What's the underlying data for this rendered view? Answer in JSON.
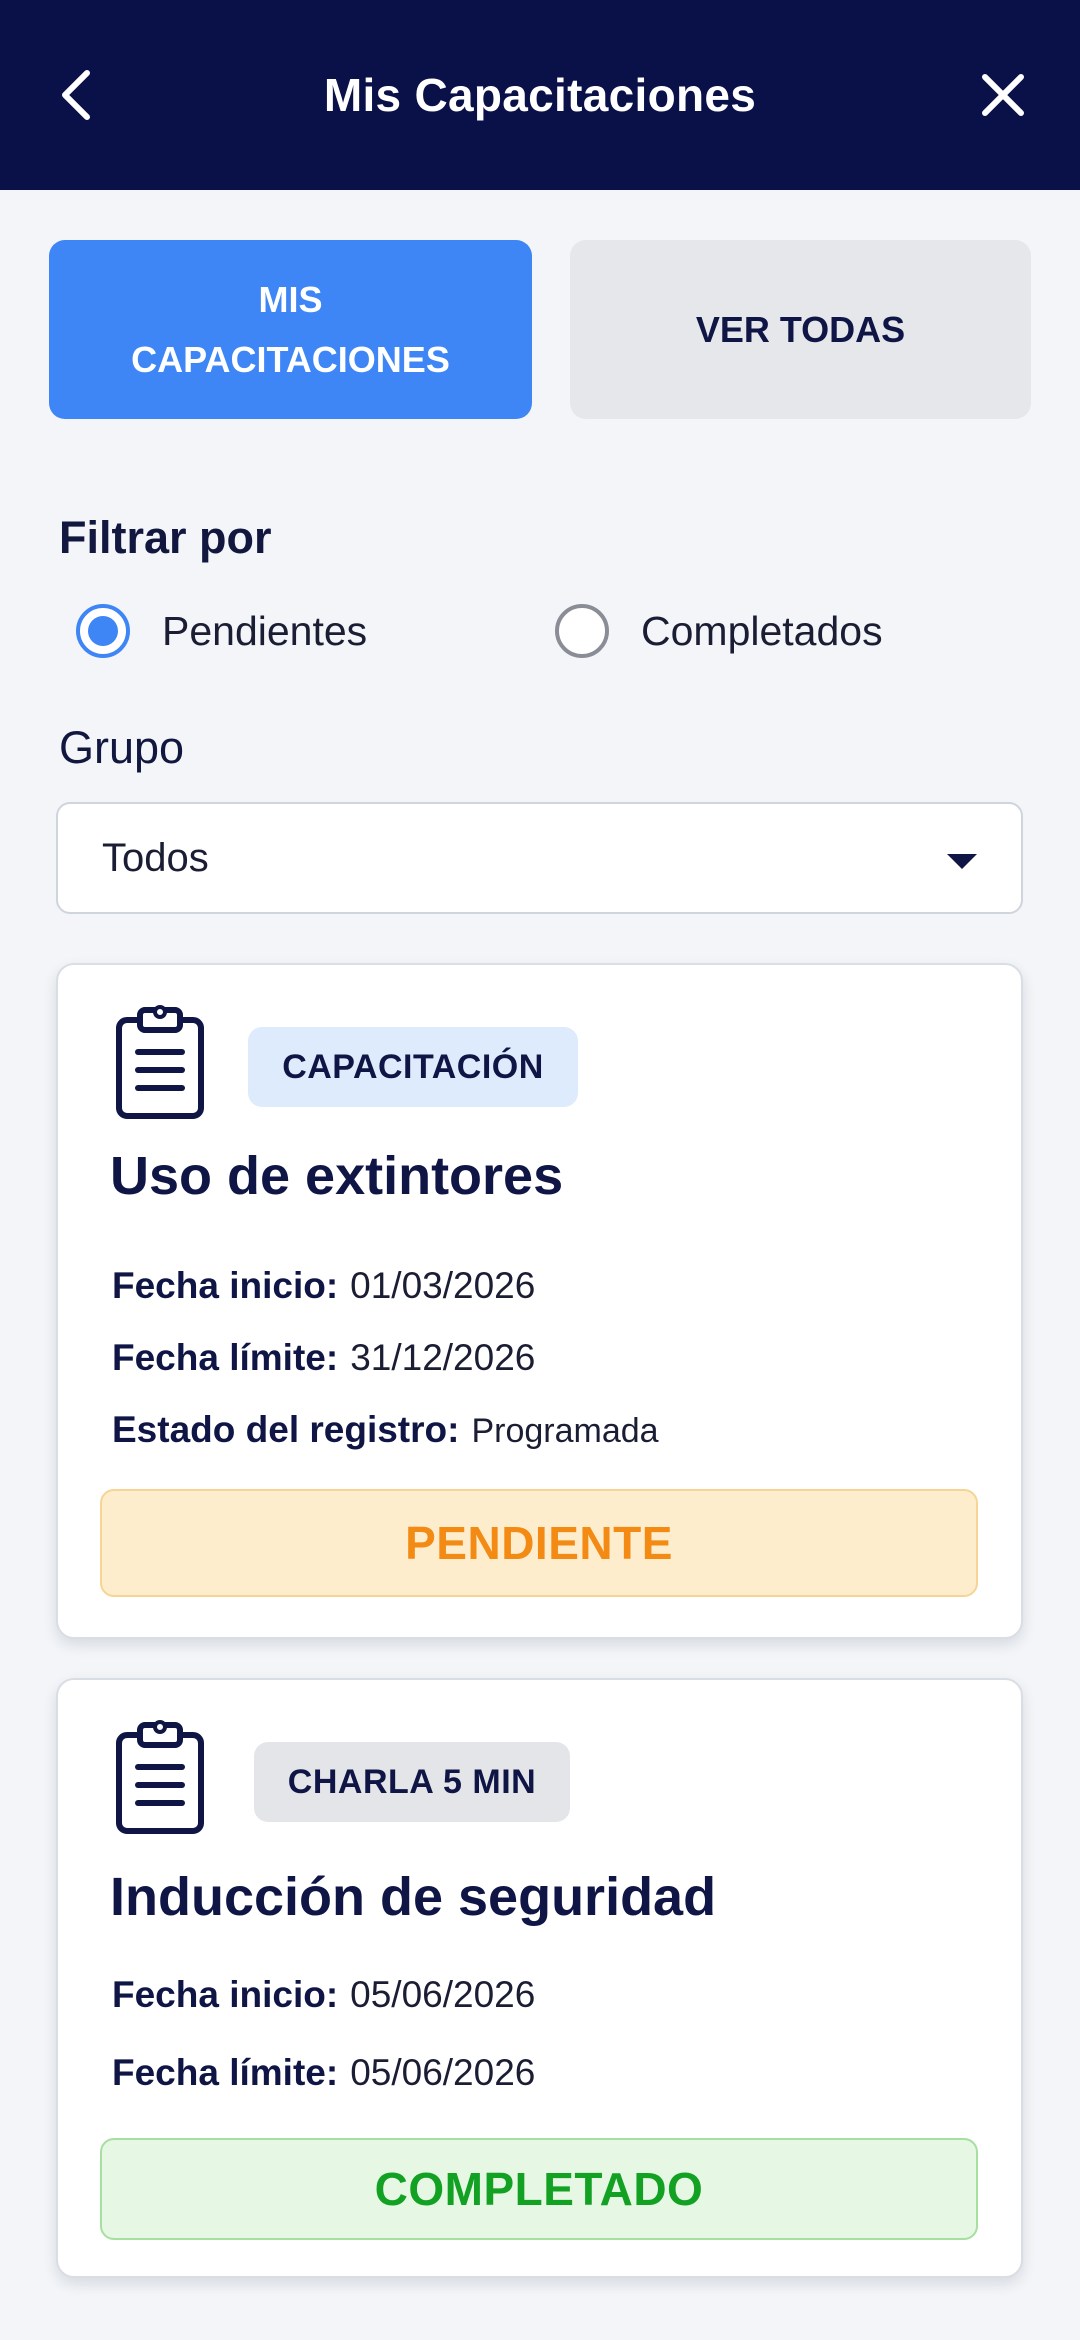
{
  "header": {
    "title": "Mis Capacitaciones",
    "back_icon": "chevron-left-icon",
    "close_icon": "close-icon"
  },
  "tabs": [
    {
      "line1": "MIS",
      "line2": "CAPACITACIONES",
      "active": true
    },
    {
      "label": "VER TODAS",
      "active": false
    }
  ],
  "filter": {
    "label": "Filtrar por",
    "options": [
      {
        "label": "Pendientes",
        "selected": true
      },
      {
        "label": "Completados",
        "selected": false
      }
    ]
  },
  "group": {
    "label": "Grupo",
    "selected": "Todos"
  },
  "cards": [
    {
      "badge": "CAPACITACIÓN",
      "title": "Uso de extintores",
      "fields": [
        {
          "label": "Fecha inicio:",
          "value": "01/03/2026"
        },
        {
          "label": "Fecha límite:",
          "value": "31/12/2026"
        },
        {
          "label": "Estado del registro:",
          "value": "Programada"
        }
      ],
      "status": "PENDIENTE"
    },
    {
      "badge": "CHARLA 5 MIN",
      "title": "Inducción de seguridad",
      "fields": [
        {
          "label": "Fecha inicio:",
          "value": "05/06/2026"
        },
        {
          "label": "Fecha límite:",
          "value": "05/06/2026"
        }
      ],
      "status": "COMPLETADO"
    }
  ],
  "colors": {
    "header_bg": "#0a1048",
    "accent": "#3e86f5",
    "pending": "#f28a13",
    "completed": "#13a124"
  }
}
